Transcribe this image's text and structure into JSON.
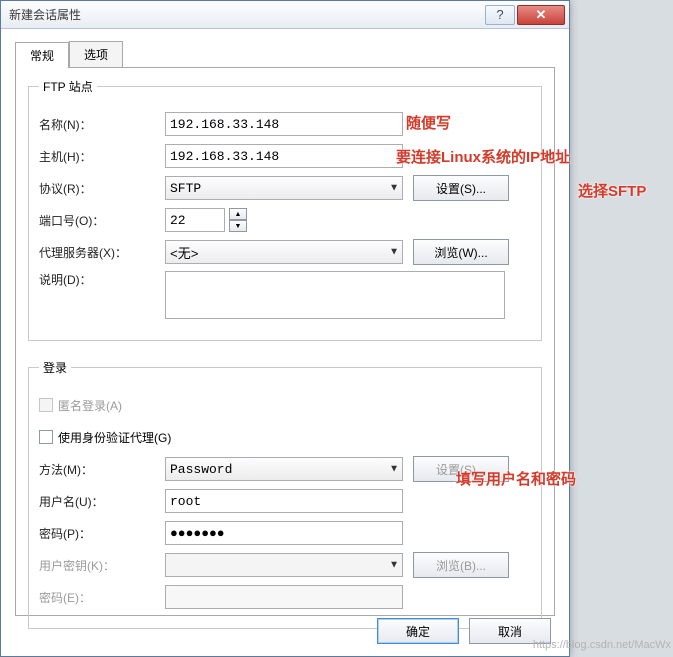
{
  "window": {
    "title": "新建会话属性"
  },
  "tabs": {
    "general": "常规",
    "options": "选项"
  },
  "ftp": {
    "legend": "FTP 站点",
    "name_label": "名称(N)：",
    "name_value": "192.168.33.148",
    "host_label": "主机(H)：",
    "host_value": "192.168.33.148",
    "protocol_label": "协议(R)：",
    "protocol_value": "SFTP",
    "settings_btn": "设置(S)...",
    "port_label": "端口号(O)：",
    "port_value": "22",
    "proxy_label": "代理服务器(X)：",
    "proxy_value": "<无>",
    "browse_btn": "浏览(W)...",
    "desc_label": "说明(D)："
  },
  "login": {
    "legend": "登录",
    "anon_label": "匿名登录(A)",
    "auth_agent_label": "使用身份验证代理(G)",
    "method_label": "方法(M)：",
    "method_value": "Password",
    "settings_btn": "设置(S)...",
    "user_label": "用户名(U)：",
    "user_value": "root",
    "pass_label": "密码(P)：",
    "pass_display": "●●●●●●●",
    "userkey_label": "用户密钥(K)：",
    "browse_btn": "浏览(B)...",
    "pass2_label": "密码(E)："
  },
  "buttons": {
    "ok": "确定",
    "cancel": "取消"
  },
  "annotations": {
    "a1": "随便写",
    "a2": "要连接Linux系统的IP地址",
    "a3": "选择SFTP",
    "a4": "填写用户名和密码"
  },
  "watermark": "https://blog.csdn.net/MacWx"
}
